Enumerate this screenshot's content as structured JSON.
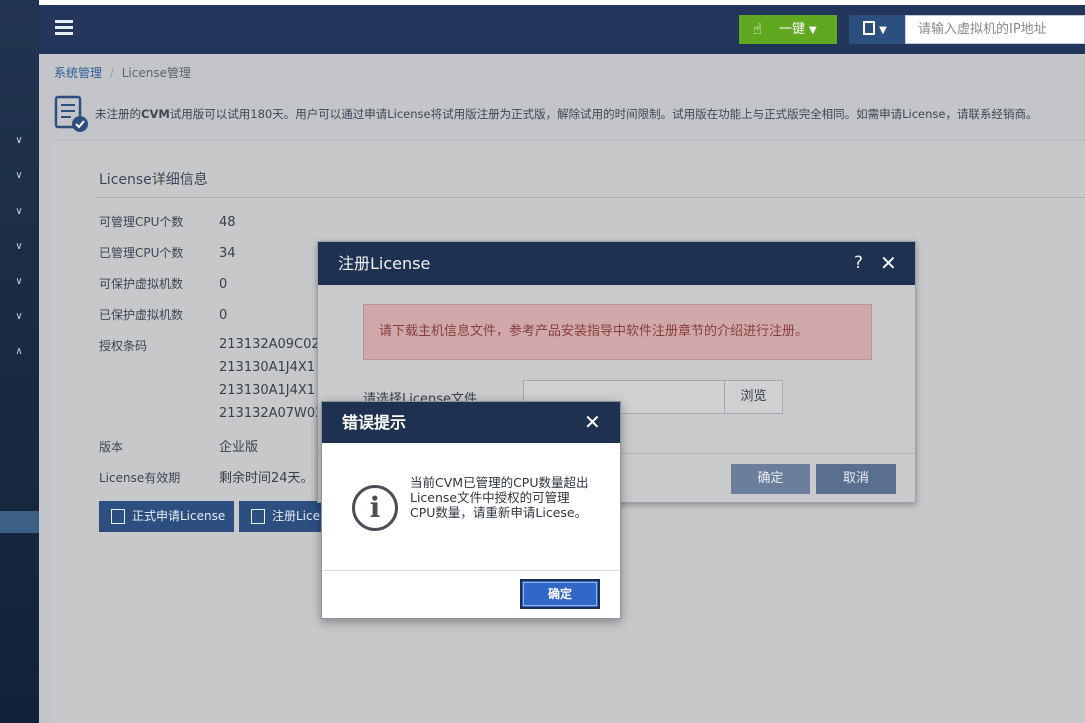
{
  "header": {
    "yijian_label": "一键",
    "search_placeholder": "请输入虚拟机的IP地址"
  },
  "breadcrumb": {
    "parent": "系统管理",
    "separator": "/",
    "current": "License管理"
  },
  "notice": {
    "text_prefix": "未注册的",
    "text_bold": "CVM",
    "text_rest": "试用版可以试用180天。用户可以通过申请License将试用版注册为正式版，解除试用的时间限制。试用版在功能上与正式版完全相同。如需申请License，请联系经销商。"
  },
  "license_detail": {
    "title": "License详细信息",
    "rows": [
      {
        "key": "可管理CPU个数",
        "value": "48"
      },
      {
        "key": "已管理CPU个数",
        "value": "34"
      },
      {
        "key": "可保护虚拟机数",
        "value": "0"
      },
      {
        "key": "已保护虚拟机数",
        "value": "0"
      },
      {
        "key": "授权条码",
        "value": "213132A09C02"
      },
      {
        "key": "版本",
        "value": "企业版"
      },
      {
        "key": "License有效期",
        "value": "剩余时间24天。"
      }
    ],
    "codes": [
      "213132A09C02",
      "213130A1J4X1",
      "213130A1J4X1",
      "213132A07W02"
    ],
    "apply_button": "正式申请License",
    "register_button": "注册License"
  },
  "register_dialog": {
    "title": "注册License",
    "help": "?",
    "close": "✕",
    "alert": "请下载主机信息文件，参考产品安装指导中软件注册章节的介绍进行注册。",
    "file_label": "请选择License文件",
    "browse": "浏览",
    "ok": "确定",
    "cancel": "取消"
  },
  "error_dialog": {
    "title": "错误提示",
    "close": "✕",
    "message": "当前CVM已管理的CPU数量超出License文件中授权的可管理CPU数量，请重新申请Licese。",
    "ok": "确定"
  },
  "sidebar": {
    "chevrons": [
      "⌄",
      "⌄",
      "⌄",
      "⌄",
      "⌄",
      "⌄",
      "⌃"
    ]
  }
}
